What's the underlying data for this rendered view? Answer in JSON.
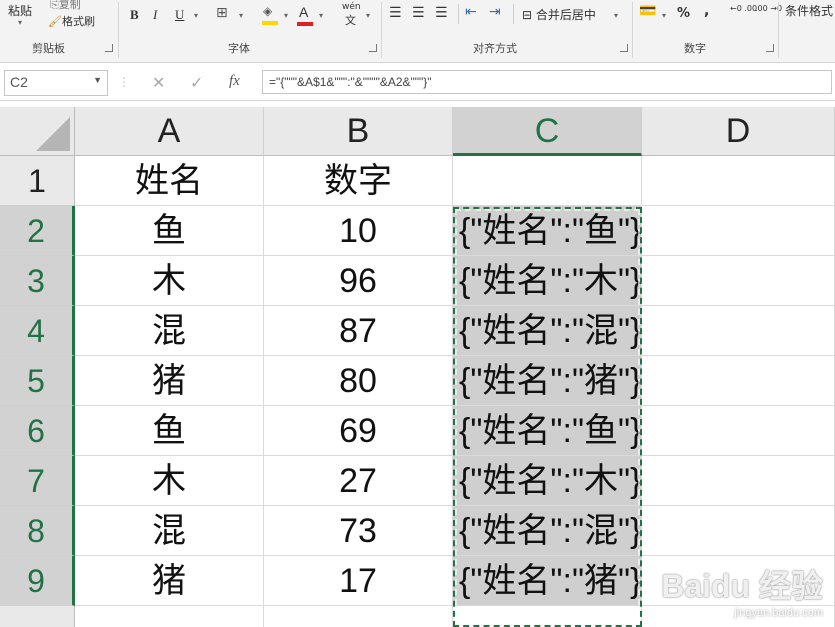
{
  "ribbon": {
    "paste": "粘贴",
    "copy": "复制",
    "format_painter": "格式刷",
    "groups": {
      "clipboard": "剪贴板",
      "font": "字体",
      "alignment": "对齐方式",
      "number": "数字",
      "styles": "条件格式"
    },
    "bold": "B",
    "italic": "I",
    "underline": "U",
    "font_color": "A",
    "phonetic": "wén",
    "merge_center": "合并后居中",
    "percent": "%",
    "comma": ",",
    "increase_decimal": "←0 .00",
    "decrease_decimal": ".00 →0"
  },
  "formula_bar": {
    "name_box": "C2",
    "cancel": "✕",
    "enter": "✓",
    "fx": "fx",
    "formula": "=\"{\"\"\"&A$1&\"\"\":\"&\"\"\"\"&A2&\"\"\"}\""
  },
  "grid": {
    "columns": [
      "A",
      "B",
      "C",
      "D"
    ],
    "selected_column": "C",
    "rows": [
      {
        "num": "1",
        "a": "姓名",
        "b": "数字",
        "c": ""
      },
      {
        "num": "2",
        "a": "鱼",
        "b": "10",
        "c": "{\"姓名\":\"鱼\"}"
      },
      {
        "num": "3",
        "a": "木",
        "b": "96",
        "c": "{\"姓名\":\"木\"}"
      },
      {
        "num": "4",
        "a": "混",
        "b": "87",
        "c": "{\"姓名\":\"混\"}"
      },
      {
        "num": "5",
        "a": "猪",
        "b": "80",
        "c": "{\"姓名\":\"猪\"}"
      },
      {
        "num": "6",
        "a": "鱼",
        "b": "69",
        "c": "{\"姓名\":\"鱼\"}"
      },
      {
        "num": "7",
        "a": "木",
        "b": "27",
        "c": "{\"姓名\":\"木\"}"
      },
      {
        "num": "8",
        "a": "混",
        "b": "73",
        "c": "{\"姓名\":\"混\"}"
      },
      {
        "num": "9",
        "a": "猪",
        "b": "17",
        "c": "{\"姓名\":\"猪\"}"
      }
    ]
  },
  "watermark": {
    "logo": "Baidu 经验",
    "url": "jingyan.baidu.com"
  },
  "colors": {
    "accent": "#217346",
    "header_bg": "#e9e9e9",
    "selected_header_bg": "#d2d2d2",
    "selected_cell_bg": "#cfcfcf"
  }
}
